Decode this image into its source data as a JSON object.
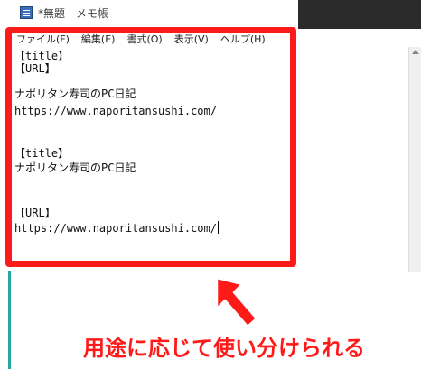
{
  "window": {
    "title": "*無題 - メモ帳"
  },
  "menu": [
    "ファイル(F)",
    "編集(E)",
    "書式(O)",
    "表示(V)",
    "ヘルプ(H)"
  ],
  "editor": {
    "lines": [
      "【title】",
      "【URL】",
      "",
      "ナポリタン寿司のPC日記",
      "https://www.naporitansushi.com/",
      "",
      "",
      "【title】",
      "ナポリタン寿司のPC日記",
      "",
      "",
      "【URL】",
      "https://www.naporitansushi.com/"
    ]
  },
  "annotation": {
    "caption": "用途に応じて使い分けられる",
    "color": "#ff1a1a"
  }
}
